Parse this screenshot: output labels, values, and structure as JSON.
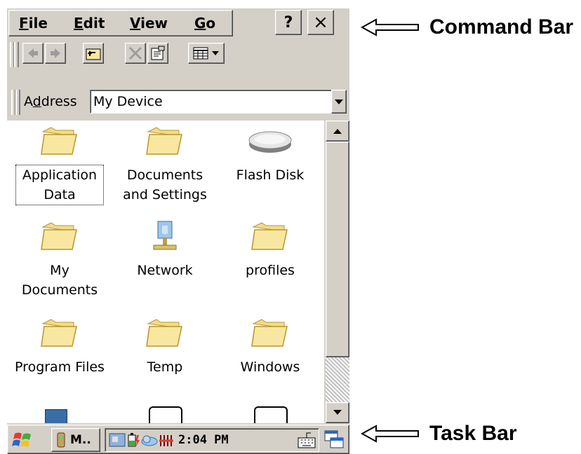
{
  "menu": {
    "file_u": "F",
    "file_rest": "ile",
    "edit_u": "E",
    "edit_rest": "dit",
    "view_u": "V",
    "view_rest": "iew",
    "go_u": "G",
    "go_rest": "o",
    "help_label": "?",
    "close_label": "×"
  },
  "address": {
    "label_pre": "A",
    "label_u": "d",
    "label_post": "dress",
    "value": "My Device"
  },
  "items": [
    {
      "label": "Application Data",
      "icon": "folder-icon",
      "selected": true
    },
    {
      "label": "Documents and Settings",
      "icon": "folder-icon"
    },
    {
      "label": "Flash Disk",
      "icon": "flash-disk-icon"
    },
    {
      "label": "My Documents",
      "icon": "folder-icon"
    },
    {
      "label": "Network",
      "icon": "network-icon"
    },
    {
      "label": "profiles",
      "icon": "folder-icon"
    },
    {
      "label": "Program Files",
      "icon": "folder-icon"
    },
    {
      "label": "Temp",
      "icon": "folder-icon"
    },
    {
      "label": "Windows",
      "icon": "folder-icon"
    }
  ],
  "taskbar": {
    "task_label": "M..",
    "time": "2:04 PM"
  },
  "annotations": {
    "command_bar": "Command Bar",
    "task_bar": "Task Bar"
  },
  "colors": {
    "chrome": "#d4d0c8",
    "folder": "#f8e7a0",
    "folder_edge": "#b8962e"
  }
}
